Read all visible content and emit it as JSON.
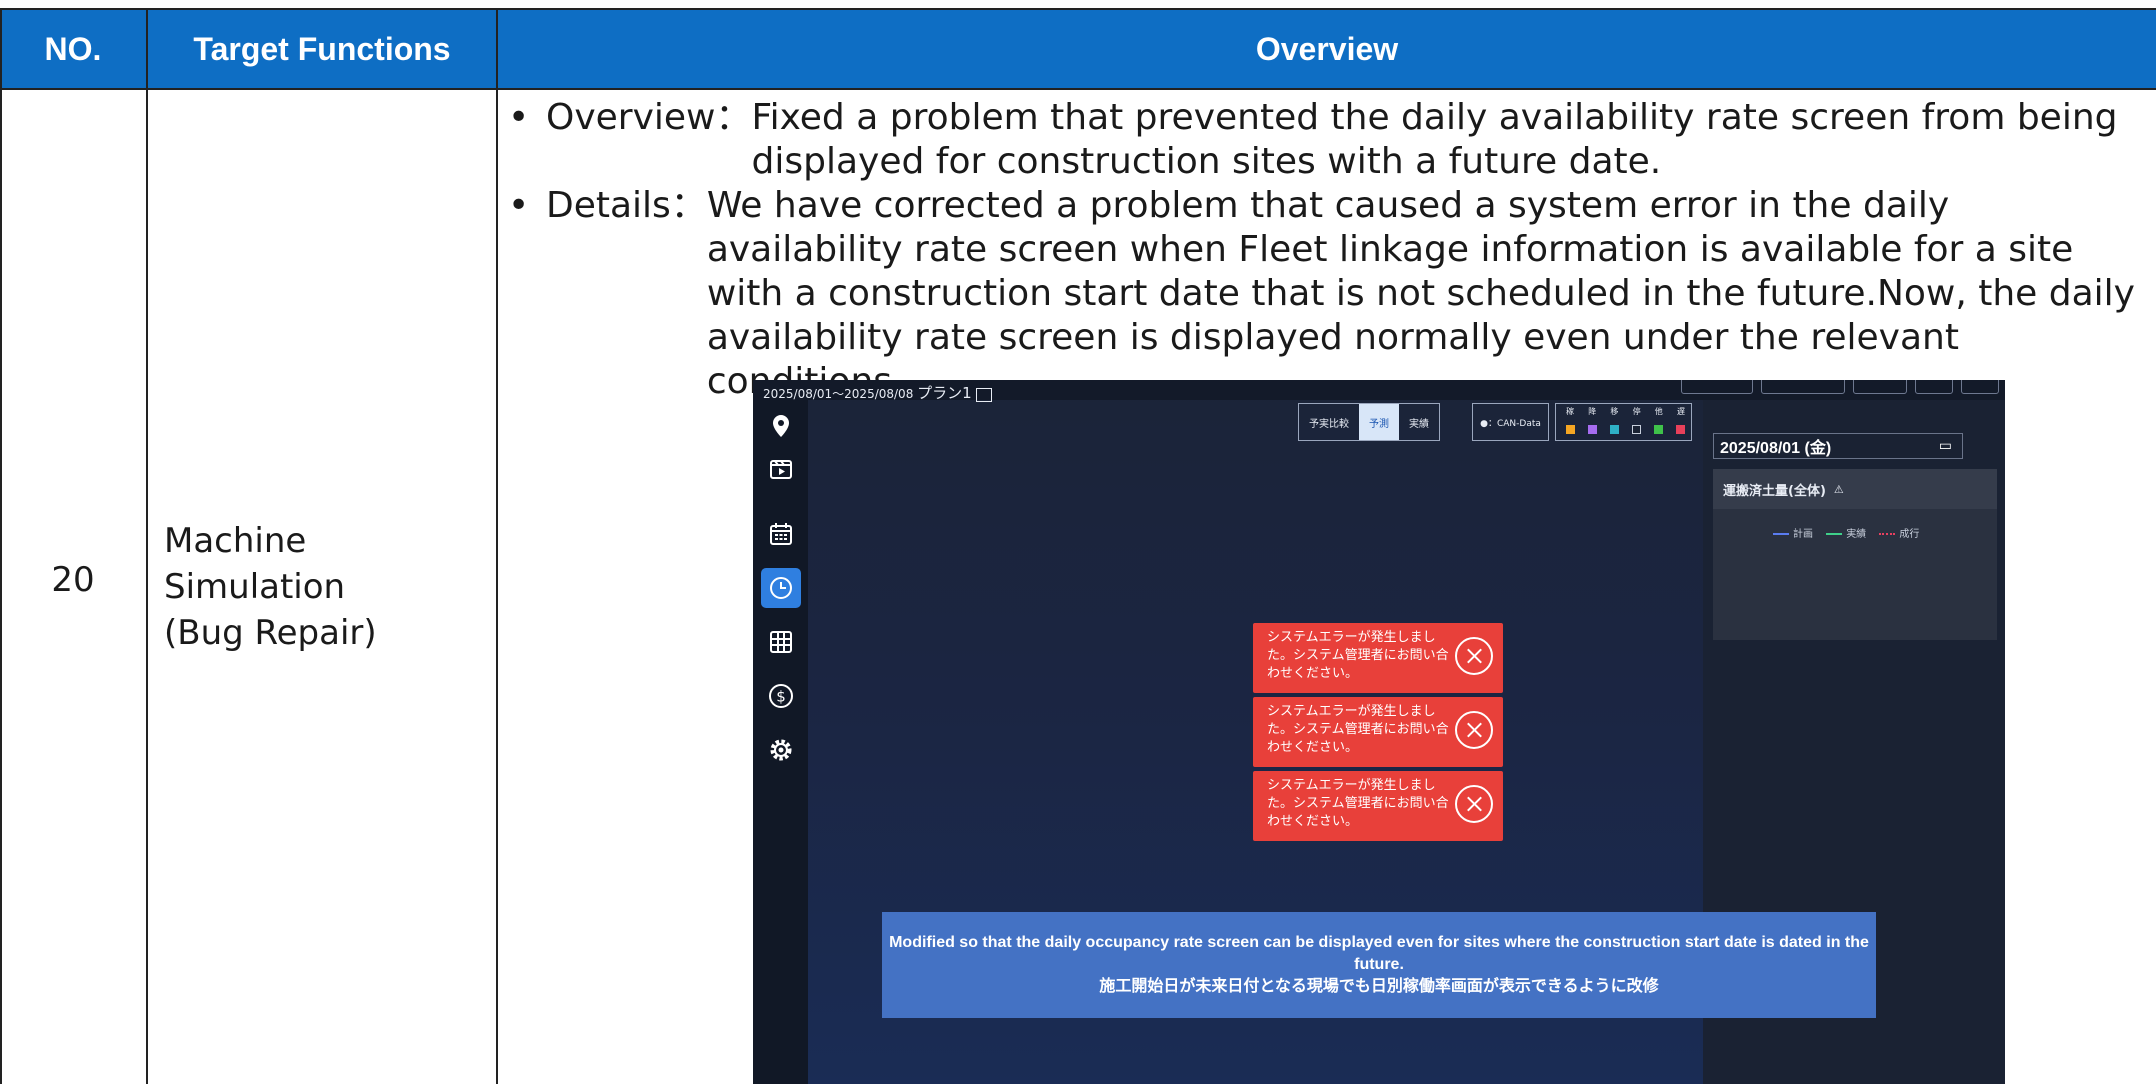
{
  "header": {
    "no": "NO.",
    "target": "Target Functions",
    "overview": "Overview"
  },
  "row": {
    "no": "20",
    "target_lines": [
      "Machine",
      "Simulation",
      "(Bug Repair)"
    ],
    "overview": {
      "label": "Overview：",
      "text": "Fixed a problem that prevented the daily availability rate screen from being displayed for construction sites with a future date."
    },
    "details": {
      "label": "Details：",
      "text": "We have corrected a problem that caused a system error in the daily availability rate screen when Fleet linkage information is available for a site with a construction start date that is not scheduled in the future.Now, the daily availability rate screen is displayed normally even under the relevant conditions."
    }
  },
  "app": {
    "period": "2025/08/01～2025/08/08",
    "plan": "プラン1",
    "toggles": [
      "予実比較",
      "予測",
      "実績"
    ],
    "can_data": "●：CAN-Data",
    "status_labels": [
      "稼",
      "降",
      "移",
      "停",
      "他",
      "遅"
    ],
    "status_colors": [
      "#f5a623",
      "#a66cf0",
      "#2fb0c6",
      "#2a3140",
      "#3fc24a",
      "#e8405a"
    ],
    "date": "2025/08/01 (金)",
    "card_title": "運搬済土量(全体)",
    "legend": [
      "計画",
      "実績",
      "成行"
    ],
    "legend_colors": [
      "#5a7cf0",
      "#3fd08a",
      "#e84060"
    ],
    "error_message": "システムエラーが発生しました。システム管理者にお問い合わせください。",
    "note_en": "Modified so that the daily occupancy rate screen can be displayed even for sites where the construction start date is dated in the future.",
    "note_ja": "施工開始日が未来日付となる現場でも日別稼働率画面が表示できるように改修",
    "sidebar_icons": [
      "map-pin-icon",
      "video-icon",
      "calendar-icon",
      "clock-icon",
      "grid-icon",
      "dollar-icon",
      "gear-icon"
    ]
  }
}
